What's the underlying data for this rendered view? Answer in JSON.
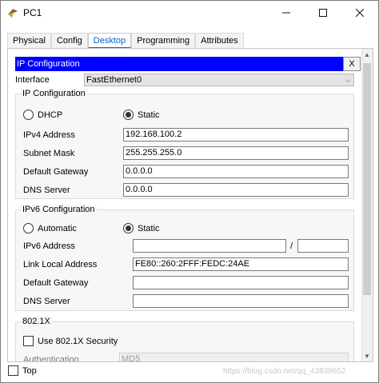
{
  "window": {
    "title": "PC1"
  },
  "tabs": [
    {
      "label": "Physical"
    },
    {
      "label": "Config"
    },
    {
      "label": "Desktop"
    },
    {
      "label": "Programming"
    },
    {
      "label": "Attributes"
    }
  ],
  "ip_config": {
    "header": "IP Configuration",
    "close_label": "X",
    "interface_label": "Interface",
    "interface_value": "FastEthernet0",
    "ipv4": {
      "title": "IP Configuration",
      "dhcp_label": "DHCP",
      "static_label": "Static",
      "selected": "Static",
      "fields": [
        {
          "label": "IPv4 Address",
          "value": "192.168.100.2"
        },
        {
          "label": "Subnet Mask",
          "value": "255.255.255.0"
        },
        {
          "label": "Default Gateway",
          "value": "0.0.0.0"
        },
        {
          "label": "DNS Server",
          "value": "0.0.0.0"
        }
      ]
    },
    "ipv6": {
      "title": "IPv6 Configuration",
      "automatic_label": "Automatic",
      "static_label": "Static",
      "selected": "Static",
      "address_label": "IPv6 Address",
      "address_value": "",
      "prefix_separator": "/",
      "prefix_value": "",
      "link_local_label": "Link Local Address",
      "link_local_value": "FE80::260:2FFF:FEDC:24AE",
      "gateway_label": "Default Gateway",
      "gateway_value": "",
      "dns_label": "DNS Server",
      "dns_value": ""
    },
    "dot1x": {
      "title": "802.1X",
      "use_label": "Use 802.1X Security",
      "use_checked": false,
      "auth_label": "Authentication",
      "auth_value": "MD5"
    }
  },
  "footer": {
    "top_label": "Top",
    "top_checked": false,
    "watermark": "https://blog.csdn.net/qq_43838652"
  }
}
